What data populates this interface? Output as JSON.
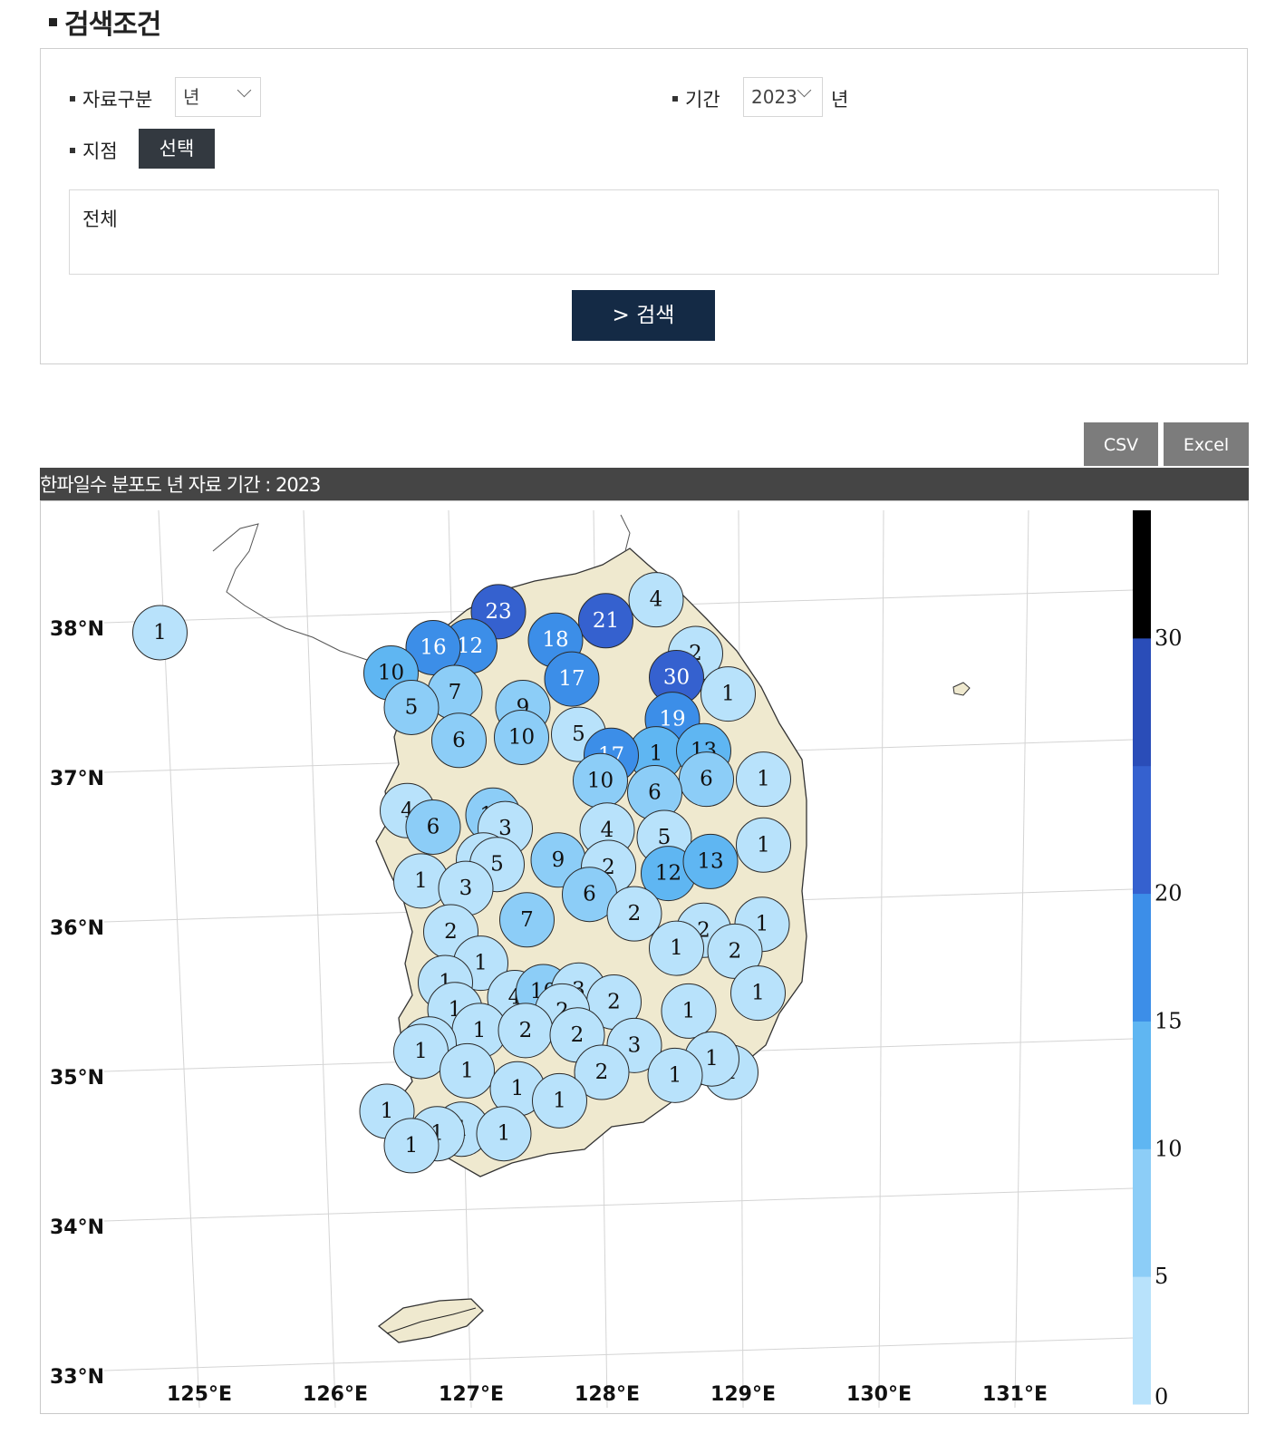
{
  "search": {
    "title": "검색조건",
    "data_type_label": "자료구분",
    "data_type_value": "년",
    "period_label": "기간",
    "period_value": "2023",
    "period_unit": "년",
    "station_label": "지점",
    "station_button": "선택",
    "station_value": "전체",
    "search_button": "> 검색"
  },
  "download": {
    "csv": "CSV",
    "excel": "Excel"
  },
  "map": {
    "title": "한파일수 분포도 년 자료 기간 : 2023",
    "lat_labels": [
      "38°N",
      "37°N",
      "36°N",
      "35°N",
      "34°N",
      "33°N"
    ],
    "lon_labels": [
      "125°E",
      "126°E",
      "127°E",
      "128°E",
      "129°E",
      "130°E",
      "131°E"
    ],
    "colorbar": {
      "ticks": [
        "0",
        "5",
        "10",
        "15",
        "20",
        "30"
      ],
      "colors": [
        "#b8e2fb",
        "#8ccdf7",
        "#5fb6f2",
        "#3c8ee8",
        "#3561cf",
        "#2a4db8",
        "#000000"
      ]
    },
    "stations": [
      {
        "v": 1,
        "c": 0,
        "lon": 124.71,
        "lat": 37.97
      },
      {
        "v": 23,
        "c": 4,
        "lon": 127.2,
        "lat": 38.11
      },
      {
        "v": 21,
        "c": 4,
        "lon": 127.99,
        "lat": 38.05
      },
      {
        "v": 4,
        "c": 0,
        "lon": 128.36,
        "lat": 38.19
      },
      {
        "v": 12,
        "c": 3,
        "lon": 126.99,
        "lat": 37.88
      },
      {
        "v": 16,
        "c": 3,
        "lon": 126.72,
        "lat": 37.87
      },
      {
        "v": 18,
        "c": 3,
        "lon": 127.62,
        "lat": 37.92
      },
      {
        "v": 2,
        "c": 0,
        "lon": 128.65,
        "lat": 37.83
      },
      {
        "v": 10,
        "c": 2,
        "lon": 126.41,
        "lat": 37.7
      },
      {
        "v": 17,
        "c": 3,
        "lon": 127.74,
        "lat": 37.66
      },
      {
        "v": 30,
        "c": 4,
        "lon": 128.51,
        "lat": 37.67
      },
      {
        "v": 7,
        "c": 1,
        "lon": 126.88,
        "lat": 37.57
      },
      {
        "v": 5,
        "c": 1,
        "lon": 126.56,
        "lat": 37.47
      },
      {
        "v": 9,
        "c": 1,
        "lon": 127.38,
        "lat": 37.47
      },
      {
        "v": 1,
        "c": 0,
        "lon": 128.89,
        "lat": 37.56
      },
      {
        "v": 19,
        "c": 3,
        "lon": 128.48,
        "lat": 37.39
      },
      {
        "v": 6,
        "c": 1,
        "lon": 126.91,
        "lat": 37.25
      },
      {
        "v": 10,
        "c": 1,
        "lon": 127.37,
        "lat": 37.27
      },
      {
        "v": 5,
        "c": 0,
        "lon": 127.79,
        "lat": 37.29
      },
      {
        "v": 1,
        "c": 2,
        "lon": 128.36,
        "lat": 37.16
      },
      {
        "v": 17,
        "c": 3,
        "lon": 128.03,
        "lat": 37.15
      },
      {
        "v": 13,
        "c": 2,
        "lon": 128.71,
        "lat": 37.18
      },
      {
        "v": 1,
        "c": 0,
        "lon": 129.15,
        "lat": 36.99
      },
      {
        "v": 10,
        "c": 1,
        "lon": 127.95,
        "lat": 36.98
      },
      {
        "v": 6,
        "c": 1,
        "lon": 128.73,
        "lat": 36.99
      },
      {
        "v": 6,
        "c": 1,
        "lon": 128.35,
        "lat": 36.9
      },
      {
        "v": 4,
        "c": 0,
        "lon": 126.53,
        "lat": 36.78
      },
      {
        "v": 6,
        "c": 1,
        "lon": 126.72,
        "lat": 36.67
      },
      {
        "v": 10,
        "c": 1,
        "lon": 127.16,
        "lat": 36.75
      },
      {
        "v": 3,
        "c": 0,
        "lon": 127.25,
        "lat": 36.66
      },
      {
        "v": 4,
        "c": 0,
        "lon": 128.0,
        "lat": 36.65
      },
      {
        "v": 5,
        "c": 0,
        "lon": 128.42,
        "lat": 36.6
      },
      {
        "v": 1,
        "c": 0,
        "lon": 129.15,
        "lat": 36.55
      },
      {
        "v": 5,
        "c": 0,
        "lon": 127.09,
        "lat": 36.45
      },
      {
        "v": 5,
        "c": 0,
        "lon": 127.19,
        "lat": 36.42
      },
      {
        "v": 9,
        "c": 1,
        "lon": 127.64,
        "lat": 36.45
      },
      {
        "v": 2,
        "c": 0,
        "lon": 128.01,
        "lat": 36.4
      },
      {
        "v": 12,
        "c": 2,
        "lon": 128.45,
        "lat": 36.36
      },
      {
        "v": 13,
        "c": 2,
        "lon": 128.76,
        "lat": 36.44
      },
      {
        "v": 1,
        "c": 0,
        "lon": 126.63,
        "lat": 36.31
      },
      {
        "v": 3,
        "c": 0,
        "lon": 126.96,
        "lat": 36.26
      },
      {
        "v": 6,
        "c": 1,
        "lon": 127.87,
        "lat": 36.22
      },
      {
        "v": 2,
        "c": 0,
        "lon": 128.2,
        "lat": 36.09
      },
      {
        "v": 7,
        "c": 1,
        "lon": 127.41,
        "lat": 36.05
      },
      {
        "v": 1,
        "c": 0,
        "lon": 129.14,
        "lat": 36.02
      },
      {
        "v": 2,
        "c": 0,
        "lon": 128.71,
        "lat": 35.98
      },
      {
        "v": 2,
        "c": 0,
        "lon": 126.85,
        "lat": 35.97
      },
      {
        "v": 1,
        "c": 0,
        "lon": 128.51,
        "lat": 35.86
      },
      {
        "v": 2,
        "c": 0,
        "lon": 128.94,
        "lat": 35.84
      },
      {
        "v": 1,
        "c": 0,
        "lon": 127.07,
        "lat": 35.76
      },
      {
        "v": 1,
        "c": 0,
        "lon": 126.81,
        "lat": 35.63
      },
      {
        "v": 1,
        "c": 0,
        "lon": 129.11,
        "lat": 35.56
      },
      {
        "v": 4,
        "c": 0,
        "lon": 127.32,
        "lat": 35.53
      },
      {
        "v": 10,
        "c": 1,
        "lon": 127.53,
        "lat": 35.57
      },
      {
        "v": 3,
        "c": 0,
        "lon": 127.79,
        "lat": 35.58
      },
      {
        "v": 2,
        "c": 0,
        "lon": 128.05,
        "lat": 35.5
      },
      {
        "v": 2,
        "c": 0,
        "lon": 127.67,
        "lat": 35.44
      },
      {
        "v": 1,
        "c": 0,
        "lon": 126.88,
        "lat": 35.45
      },
      {
        "v": 1,
        "c": 0,
        "lon": 128.6,
        "lat": 35.44
      },
      {
        "v": 1,
        "c": 0,
        "lon": 127.06,
        "lat": 35.31
      },
      {
        "v": 2,
        "c": 0,
        "lon": 127.4,
        "lat": 35.31
      },
      {
        "v": 2,
        "c": 0,
        "lon": 127.78,
        "lat": 35.28
      },
      {
        "v": 3,
        "c": 0,
        "lon": 128.2,
        "lat": 35.21
      },
      {
        "v": 2,
        "c": 0,
        "lon": 126.69,
        "lat": 35.22
      },
      {
        "v": 1,
        "c": 0,
        "lon": 126.63,
        "lat": 35.17
      },
      {
        "v": 1,
        "c": 0,
        "lon": 128.91,
        "lat": 35.03
      },
      {
        "v": 1,
        "c": 0,
        "lon": 128.77,
        "lat": 35.12
      },
      {
        "v": 1,
        "c": 0,
        "lon": 128.5,
        "lat": 35.01
      },
      {
        "v": 1,
        "c": 0,
        "lon": 126.97,
        "lat": 35.04
      },
      {
        "v": 2,
        "c": 0,
        "lon": 127.96,
        "lat": 35.03
      },
      {
        "v": 1,
        "c": 0,
        "lon": 127.34,
        "lat": 34.92
      },
      {
        "v": 1,
        "c": 0,
        "lon": 127.65,
        "lat": 34.84
      },
      {
        "v": 1,
        "c": 0,
        "lon": 126.38,
        "lat": 34.77
      },
      {
        "v": 1,
        "c": 0,
        "lon": 126.93,
        "lat": 34.65
      },
      {
        "v": 1,
        "c": 0,
        "lon": 126.75,
        "lat": 34.62
      },
      {
        "v": 1,
        "c": 0,
        "lon": 127.24,
        "lat": 34.62
      },
      {
        "v": 1,
        "c": 0,
        "lon": 126.56,
        "lat": 34.54
      }
    ]
  }
}
